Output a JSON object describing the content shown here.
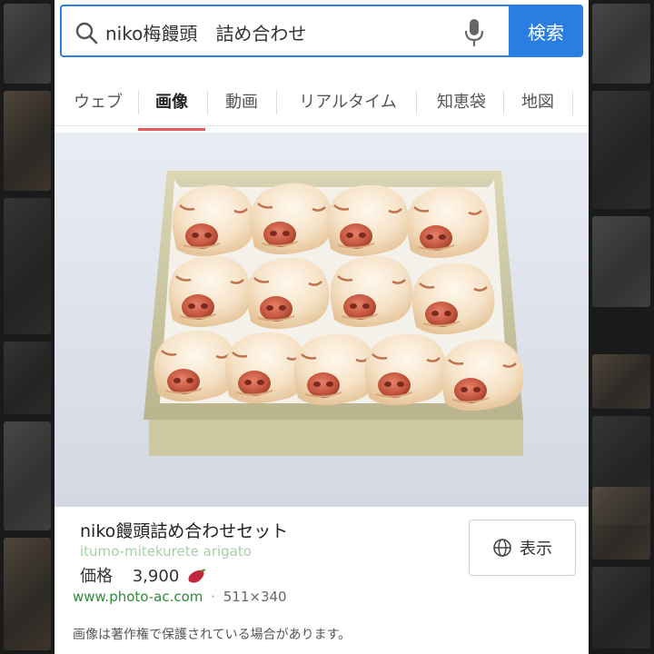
{
  "search": {
    "query": "niko梅饅頭　詰め合わせ",
    "button_label": "検索",
    "search_icon": "search-icon",
    "mic_icon": "mic-icon"
  },
  "tabs": [
    {
      "label": "ウェブ",
      "active": false
    },
    {
      "label": "画像",
      "active": true
    },
    {
      "label": "動画",
      "active": false
    },
    {
      "label": "リアルタイム",
      "active": false
    },
    {
      "label": "知恵袋",
      "active": false
    },
    {
      "label": "地図",
      "active": false
    }
  ],
  "result": {
    "title": "niko饅頭詰め合わせセット",
    "subtitle": "itumo-mitekurete arigato",
    "price_label": "価格",
    "price_value": "3,900",
    "price_icon": "sweet-potato-icon",
    "source_url": "www.photo-ac.com",
    "separator": "·",
    "image_size": "511×340",
    "view_label": "表示",
    "view_icon": "globe-icon",
    "copyright_notice": "画像は著作権で保護されている場合があります。"
  },
  "colors": {
    "accent": "#2a7de1",
    "active_tab_underline": "#e85a5a",
    "source_url": "#2e8b3a",
    "subtitle": "#a8d0a8"
  }
}
